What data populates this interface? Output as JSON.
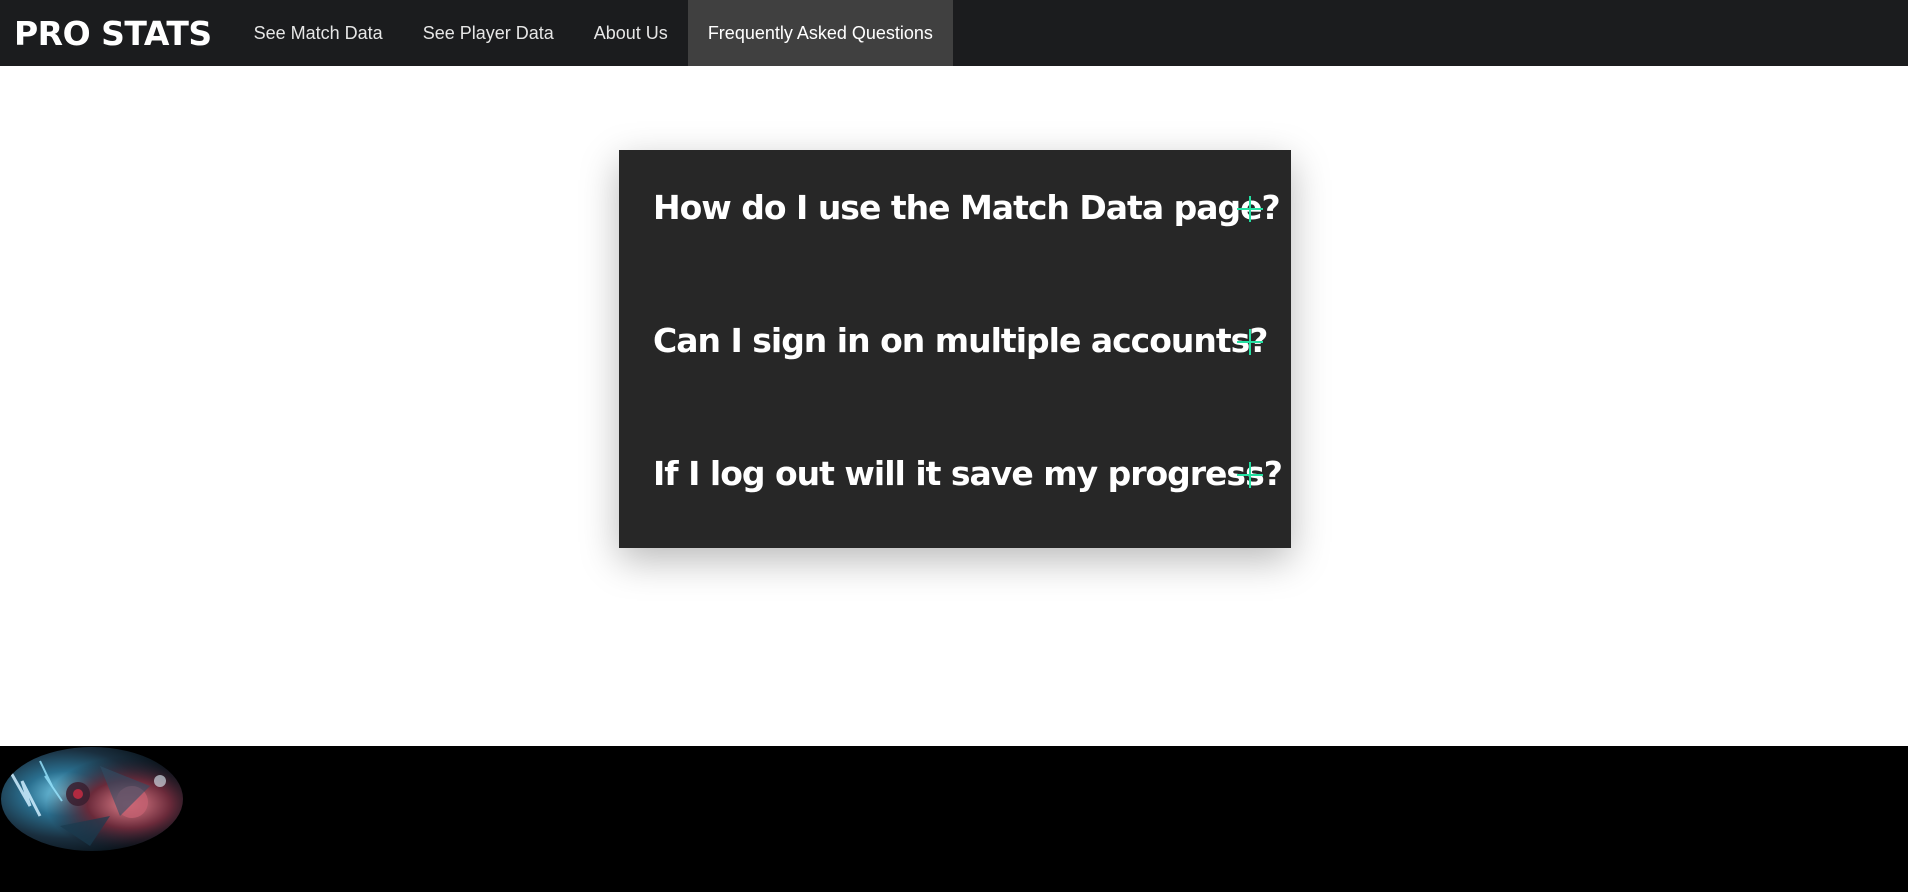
{
  "nav": {
    "brand": "PRO STATS",
    "links": [
      {
        "label": "See Match Data"
      },
      {
        "label": "See Player Data"
      },
      {
        "label": "About Us"
      },
      {
        "label": "Frequently Asked Questions"
      }
    ],
    "active_index": 3
  },
  "faq": {
    "items": [
      {
        "question": "How do I use the Match Data page?",
        "toggle_icon": "plus-icon"
      },
      {
        "question": "Can I sign in on multiple accounts?",
        "toggle_icon": "plus-icon"
      },
      {
        "question": "If I log out will it save my progress?",
        "toggle_icon": "plus-icon"
      }
    ]
  },
  "colors": {
    "nav_background": "#1b1c1e",
    "nav_active": "#404040",
    "panel_background": "#272727",
    "accent": "#24e0a2",
    "footer_background": "#000000"
  }
}
